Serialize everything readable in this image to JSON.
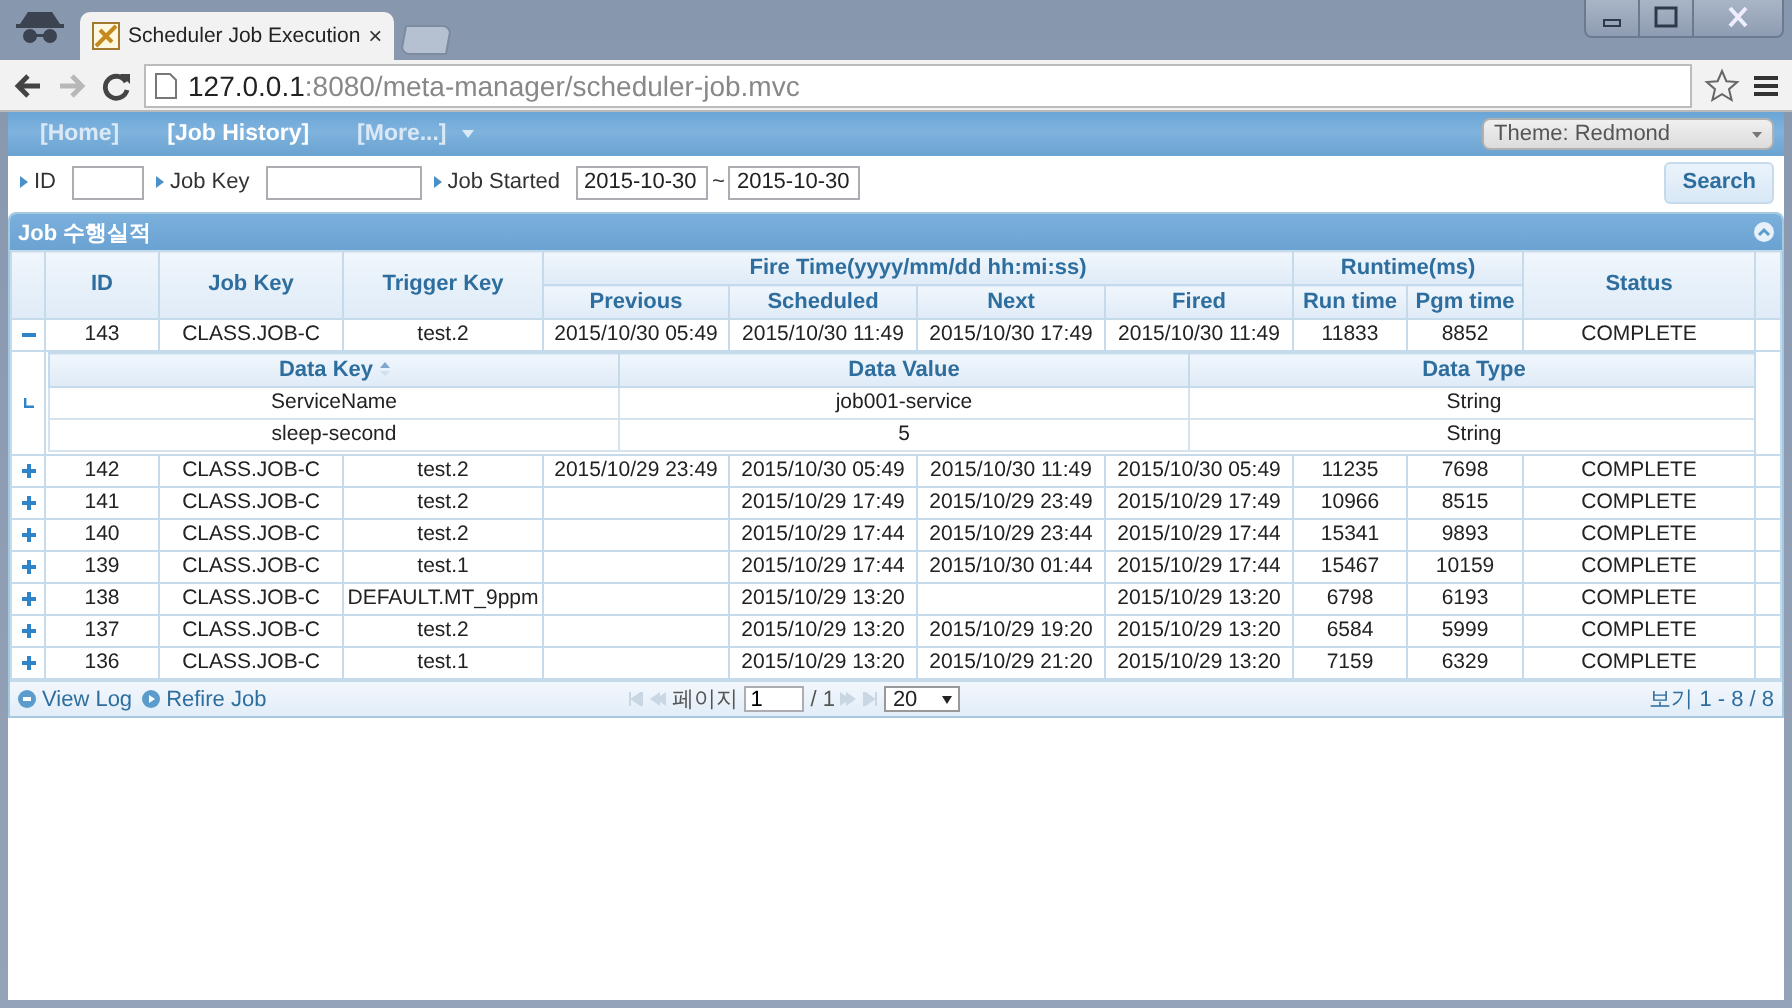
{
  "browser": {
    "tab_title": "Scheduler Job Execution",
    "tab_close": "×",
    "url_host": "127.0.0.1",
    "url_rest": ":8080/meta-manager/scheduler-job.mvc",
    "forward_disabled": true
  },
  "nav": {
    "items": [
      {
        "label": "[Home]",
        "selected": false,
        "dropdown": false
      },
      {
        "label": "[Job History]",
        "selected": true,
        "dropdown": false
      },
      {
        "label": "[More...]",
        "selected": false,
        "dropdown": true
      }
    ],
    "theme": "Theme: Redmond"
  },
  "search": {
    "fields": [
      {
        "kind": "text",
        "label": "ID"
      },
      {
        "kind": "text",
        "label": "Job Key"
      },
      {
        "kind": "date_range",
        "label": "Job Started",
        "from": "2015-10-30",
        "separator": "~",
        "to": "2015-10-30"
      }
    ],
    "button": "Search"
  },
  "grid": {
    "title": "Job 수행실적",
    "columns": [
      {
        "label": "ID"
      },
      {
        "label": "Job Key"
      },
      {
        "label": "Trigger Key"
      },
      {
        "label": "Fire Time(yyyy/mm/dd hh:mi:ss)",
        "colspan": 4,
        "children": [
          "Previous",
          "Scheduled",
          "Next",
          "Fired"
        ]
      },
      {
        "label": "Runtime(ms)",
        "colspan": 2,
        "children": [
          "Run time",
          "Pgm time"
        ]
      },
      {
        "label": "Status"
      }
    ],
    "rows": [
      {
        "expanded": true,
        "cells": [
          "143",
          "CLASS.JOB-C",
          "test.2",
          "2015/10/30 05:49",
          "2015/10/30 11:49",
          "2015/10/30 17:49",
          "2015/10/30 11:49",
          "11833",
          "8852",
          "COMPLETE"
        ],
        "detail": {
          "columns": [
            {
              "label": "Data Key",
              "sorted": true
            },
            {
              "label": "Data Value",
              "sorted": false
            },
            {
              "label": "Data Type",
              "sorted": false
            }
          ],
          "rows": [
            [
              "ServiceName",
              "job001-service",
              "String"
            ],
            [
              "sleep-second",
              "5",
              "String"
            ]
          ]
        }
      },
      {
        "expanded": false,
        "cells": [
          "142",
          "CLASS.JOB-C",
          "test.2",
          "2015/10/29 23:49",
          "2015/10/30 05:49",
          "2015/10/30 11:49",
          "2015/10/30 05:49",
          "11235",
          "7698",
          "COMPLETE"
        ]
      },
      {
        "expanded": false,
        "cells": [
          "141",
          "CLASS.JOB-C",
          "test.2",
          null,
          "2015/10/29 17:49",
          "2015/10/29 23:49",
          "2015/10/29 17:49",
          "10966",
          "8515",
          "COMPLETE"
        ]
      },
      {
        "expanded": false,
        "cells": [
          "140",
          "CLASS.JOB-C",
          "test.2",
          null,
          "2015/10/29 17:44",
          "2015/10/29 23:44",
          "2015/10/29 17:44",
          "15341",
          "9893",
          "COMPLETE"
        ]
      },
      {
        "expanded": false,
        "cells": [
          "139",
          "CLASS.JOB-C",
          "test.1",
          null,
          "2015/10/29 17:44",
          "2015/10/30 01:44",
          "2015/10/29 17:44",
          "15467",
          "10159",
          "COMPLETE"
        ]
      },
      {
        "expanded": false,
        "cells": [
          "138",
          "CLASS.JOB-C",
          "DEFAULT.MT_9ppm",
          null,
          "2015/10/29 13:20",
          null,
          "2015/10/29 13:20",
          "6798",
          "6193",
          "COMPLETE"
        ]
      },
      {
        "expanded": false,
        "cells": [
          "137",
          "CLASS.JOB-C",
          "test.2",
          null,
          "2015/10/29 13:20",
          "2015/10/29 19:20",
          "2015/10/29 13:20",
          "6584",
          "5999",
          "COMPLETE"
        ]
      },
      {
        "expanded": false,
        "cells": [
          "136",
          "CLASS.JOB-C",
          "test.1",
          null,
          "2015/10/29 13:20",
          "2015/10/29 21:20",
          "2015/10/29 13:20",
          "7159",
          "6329",
          "COMPLETE"
        ]
      }
    ],
    "footer": {
      "actions": [
        {
          "kind": "log",
          "label": "View Log"
        },
        {
          "kind": "refire",
          "label": "Refire Job"
        }
      ],
      "page_label": "페이지",
      "page": "1",
      "page_total": "/ 1",
      "page_size": "20",
      "summary": "보기 1 - 8 / 8"
    }
  }
}
